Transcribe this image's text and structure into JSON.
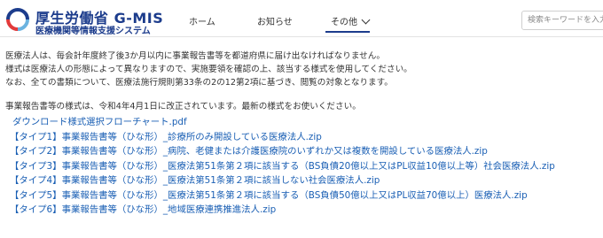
{
  "header": {
    "logo_title": "厚生労働省 G-MIS",
    "logo_subtitle": "医療機関等情報支援システム",
    "nav": {
      "home": "ホーム",
      "news": "お知らせ",
      "other": "その他"
    },
    "search_placeholder": "検索キーワードを入力",
    "brand_color": "#1c3c8c",
    "link_color": "#1a5fb4"
  },
  "main": {
    "paragraphs": [
      "医療法人は、毎会計年度終了後3か月以内に事業報告書等を都道府県に届け出なければなりません。",
      "様式は医療法人の形態によって異なりますので、実施要領を確認の上、該当する様式を使用してください。",
      "なお、全ての書類について、医療法施行規則第33条の2の12第2項に基づき、閲覧の対象となります。"
    ],
    "notice": "事業報告書等の様式は、令和4年4月1日に改正されています。最新の様式をお使いください。",
    "links": [
      "ダウンロード様式選択フローチャート.pdf",
      "【タイプ1】事業報告書等（ひな形）_診療所のみ開設している医療法人.zip",
      "【タイプ2】事業報告書等（ひな形）_病院、老健または介護医療院のいずれか又は複数を開設している医療法人.zip",
      "【タイプ3】事業報告書等（ひな形）_医療法第51条第２項に該当する（BS負債20億以上又はPL収益10億以上等）社会医療法人.zip",
      "【タイプ4】事業報告書等（ひな形）_医療法第51条第２項に該当しない社会医療法人.zip",
      "【タイプ5】事業報告書等（ひな形）_医療法第51条第２項に該当する（BS負債50億以上又はPL収益70億以上）医療法人.zip",
      "【タイプ6】事業報告書等（ひな形）_地域医療連携推進法人.zip"
    ]
  }
}
